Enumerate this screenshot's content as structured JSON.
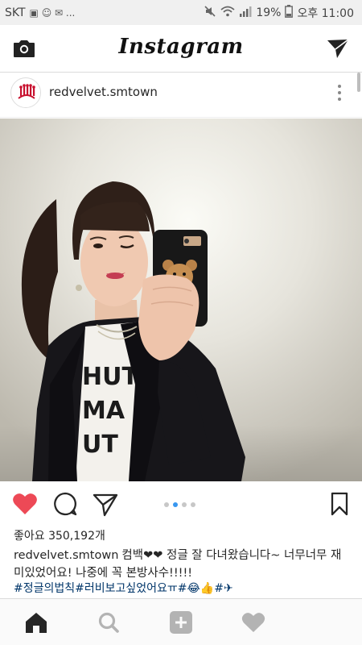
{
  "status_bar": {
    "carrier": "SKT",
    "notification_icons": "▣ ☺ ✉ ...",
    "battery_percent": "19%",
    "time": "오후 11:00"
  },
  "header": {
    "logo": "Instagram"
  },
  "post": {
    "username": "redvelvet.smtown",
    "carousel": {
      "count": 4,
      "active_index": 1
    },
    "likes_text": "좋아요 350,192개",
    "caption_user": "redvelvet.smtown",
    "caption_text": "컴백❤❤ 정글 잘 다녀왔습니다~ 너무너무 재미있었어요! 나중에 꼭 본방사수!!!!!",
    "hashtags_text": "#정글의법칙#러비보고싶었어요ㅠ#😂👍#✈"
  },
  "colors": {
    "like_heart": "#ed4956",
    "link": "#003569",
    "carousel_active": "#3897f0"
  },
  "icons": {
    "header": [
      "camera-icon",
      "direct-message-icon"
    ],
    "actions": [
      "heart-icon",
      "comment-icon",
      "share-icon",
      "bookmark-icon"
    ],
    "nav": [
      "home-icon",
      "search-icon",
      "add-post-icon",
      "activity-heart-icon"
    ]
  }
}
